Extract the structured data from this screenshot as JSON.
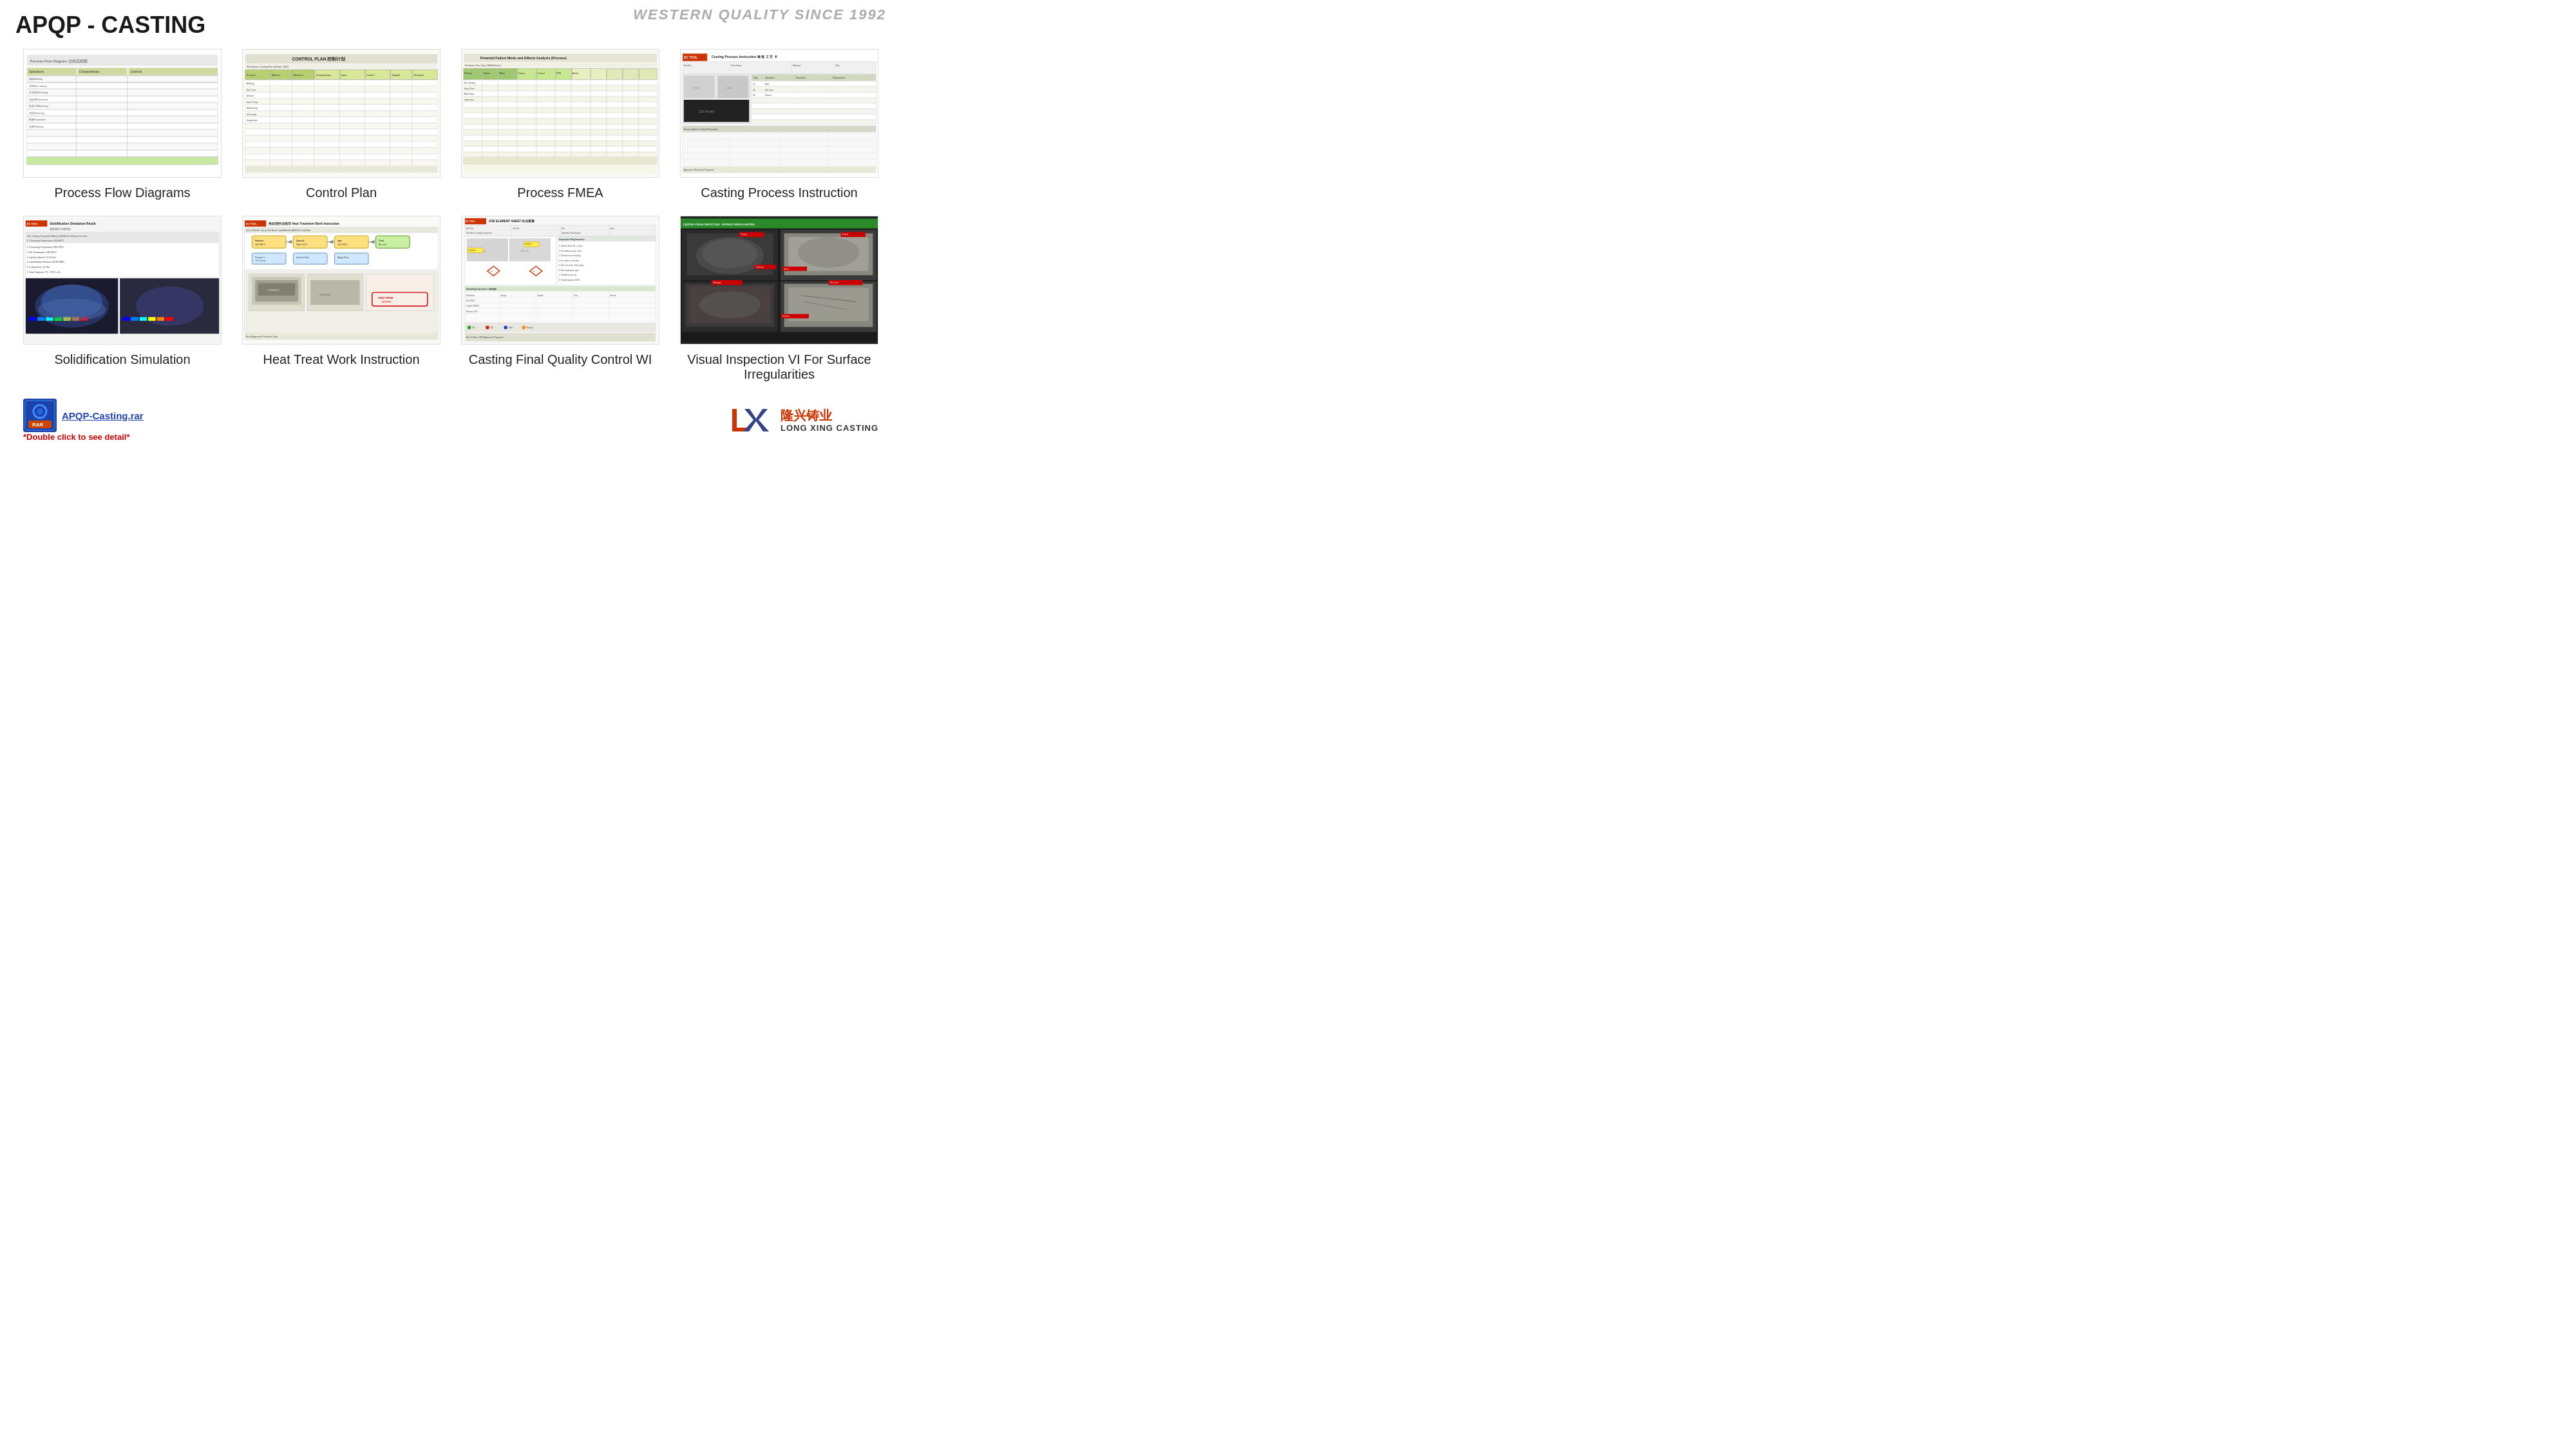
{
  "page": {
    "title": "APQP - CASTING",
    "brand_header": "WESTERN QUALITY SINCE 1992"
  },
  "grid_row1": [
    {
      "id": "pfd",
      "label": "Process Flow Diagrams",
      "thumb_type": "document"
    },
    {
      "id": "cp",
      "label": "Control Plan",
      "thumb_type": "document"
    },
    {
      "id": "fmea",
      "label": "Process FMEA",
      "thumb_type": "document"
    },
    {
      "id": "cpi",
      "label": "Casting Process Instruction",
      "thumb_type": "document"
    }
  ],
  "grid_row2": [
    {
      "id": "ss",
      "label": "Solidification Simulation",
      "thumb_type": "simulation"
    },
    {
      "id": "ht",
      "label": "Heat Treat Work Instruction",
      "thumb_type": "document"
    },
    {
      "id": "cfq",
      "label": "Casting Final Quality Control WI",
      "thumb_type": "job_element"
    },
    {
      "id": "vi",
      "label": "Visual Inspection VI For Surface Irregularities",
      "thumb_type": "photo"
    }
  ],
  "bottom": {
    "rar_filename": "APQP-Casting.rar",
    "rar_note": "*Double click to see detail*",
    "brand_chinese": "隆兴铸业",
    "brand_english": "LONG XING CASTING"
  }
}
